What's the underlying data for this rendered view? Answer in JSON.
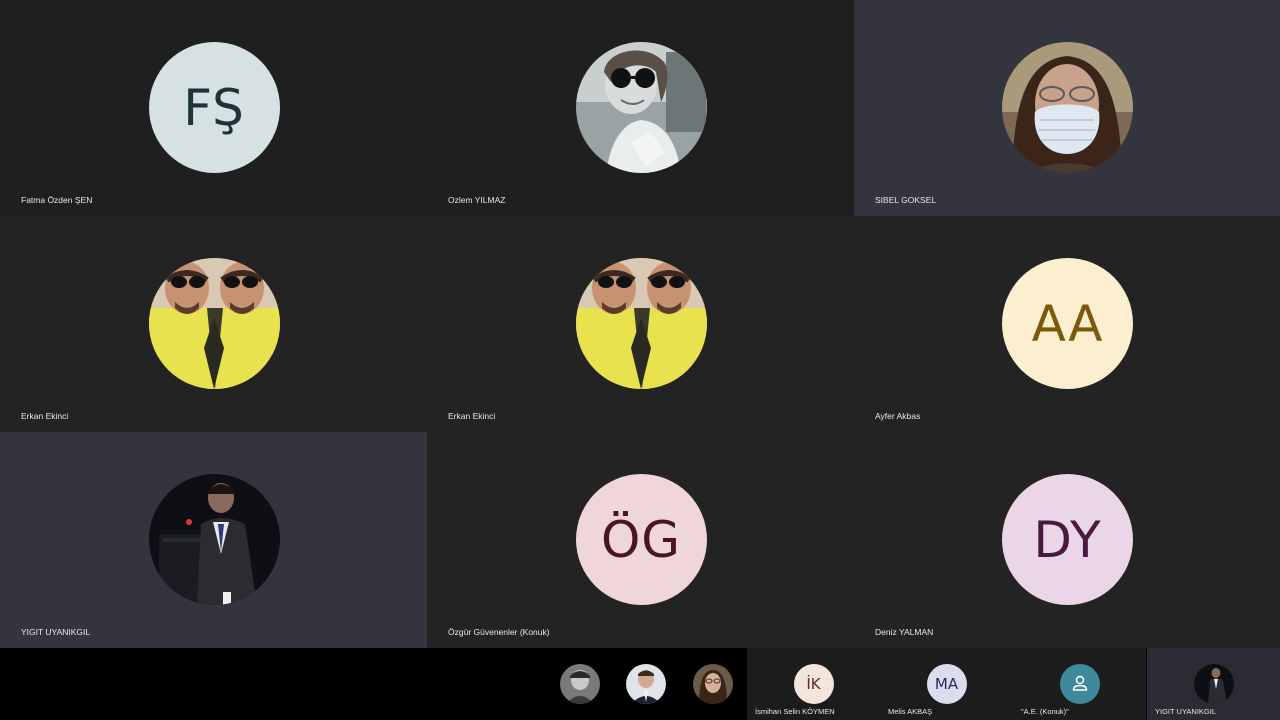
{
  "tiles": [
    {
      "name": "Fatma Özden ŞEN",
      "initials": "FŞ",
      "avatar_type": "initials",
      "bg": "#d5e1e3",
      "fg": "#1e3438"
    },
    {
      "name": "Ozlem YILMAZ",
      "avatar_type": "photo-bw-portrait-sunglasses"
    },
    {
      "name": "SIBEL GOKSEL",
      "avatar_type": "photo-woman-face-mask"
    },
    {
      "name": "Erkan Ekinci",
      "avatar_type": "photo-mirrored-sunglasses-yellow"
    },
    {
      "name": "Erkan Ekinci",
      "avatar_type": "photo-mirrored-sunglasses-yellow"
    },
    {
      "name": "Ayfer Akbas",
      "initials": "AA",
      "avatar_type": "initials",
      "bg": "#fcefcf",
      "fg": "#7a5a0a"
    },
    {
      "name": "YIGIT UYANIKGIL",
      "avatar_type": "photo-speaker-podium"
    },
    {
      "name": "Özgür Güvenenler (Konuk)",
      "initials": "ÖG",
      "avatar_type": "initials",
      "bg": "#efd6d8",
      "fg": "#4a1522"
    },
    {
      "name": "Deniz YALMAN",
      "initials": "DY",
      "avatar_type": "initials",
      "bg": "#ead6e6",
      "fg": "#4a1a3e"
    }
  ],
  "overflow_thumbs": [
    {
      "avatar_type": "photo-bw-man"
    },
    {
      "avatar_type": "photo-man-suit"
    },
    {
      "avatar_type": "photo-woman-glasses"
    }
  ],
  "participants": [
    {
      "name": "İsmihan Selin KÖYMEN",
      "initials": "İK",
      "avatar_type": "initials",
      "bg": "#f3e4dc",
      "fg": "#5a2c1e"
    },
    {
      "name": "Melis AKBAŞ",
      "initials": "MA",
      "avatar_type": "initials",
      "bg": "#dcdcef",
      "fg": "#2a2a5a"
    },
    {
      "name": "\"A.E. (Konuk)\"",
      "avatar_type": "guest-person-icon",
      "bg": "#3f8a9a"
    },
    {
      "name": "YIGIT UYANIKGIL",
      "avatar_type": "photo-speaker-podium"
    }
  ],
  "colors": {
    "tile_dark": "#1f1f1f",
    "tile_mid": "#232323",
    "tile_light": "#33343e",
    "strip_bg": "#000000",
    "participant_bg": "#1c1c1c"
  }
}
